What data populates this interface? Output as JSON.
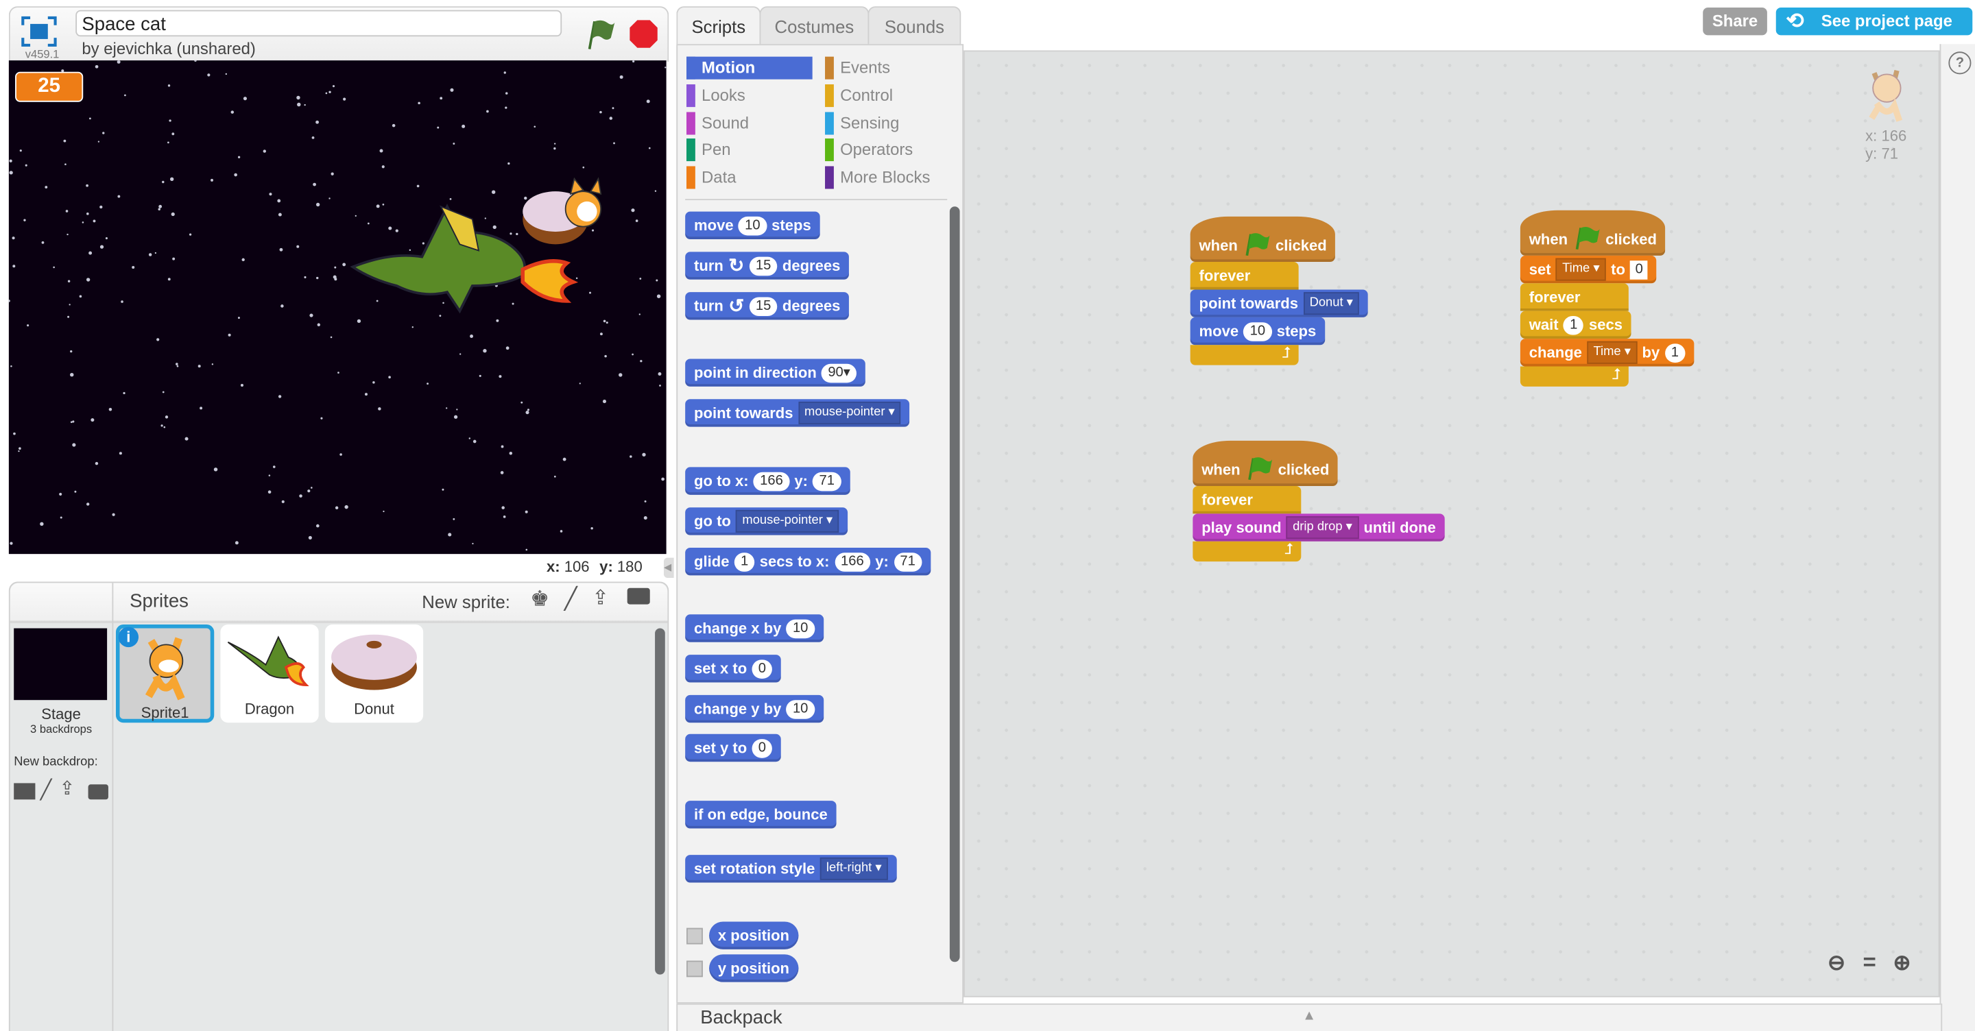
{
  "project": {
    "title": "Space cat",
    "byline": "by ejevichka (unshared)",
    "version": "v459.1"
  },
  "stage": {
    "monitor_value": "25",
    "mouse_x_label": "x:",
    "mouse_x": "106",
    "mouse_y_label": "y:",
    "mouse_y": "180",
    "background": "#0a0011"
  },
  "sprites_pane": {
    "title": "Sprites",
    "new_sprite_label": "New sprite:",
    "stage_label": "Stage",
    "stage_sub": "3 backdrops",
    "new_backdrop_label": "New backdrop:",
    "sprites": [
      {
        "name": "Sprite1",
        "selected": true
      },
      {
        "name": "Dragon"
      },
      {
        "name": "Donut"
      }
    ]
  },
  "tabs": [
    {
      "label": "Scripts",
      "active": true
    },
    {
      "label": "Costumes"
    },
    {
      "label": "Sounds"
    }
  ],
  "header_buttons": {
    "share": "Share",
    "see_project": "See project page"
  },
  "categories": [
    {
      "label": "Motion",
      "color": "#4a6cd4",
      "active": true
    },
    {
      "label": "Events",
      "color": "#c88330"
    },
    {
      "label": "Looks",
      "color": "#8a55d7"
    },
    {
      "label": "Control",
      "color": "#e1a91a"
    },
    {
      "label": "Sound",
      "color": "#bb42c3"
    },
    {
      "label": "Sensing",
      "color": "#2ca5e2"
    },
    {
      "label": "Pen",
      "color": "#0e9a6c"
    },
    {
      "label": "Operators",
      "color": "#5cb712"
    },
    {
      "label": "Data",
      "color": "#ee7d16"
    },
    {
      "label": "More Blocks",
      "color": "#632d99"
    }
  ],
  "colors": {
    "motion": "#4a6cd4",
    "events": "#c88330",
    "control": "#e1a91a",
    "data": "#ee7d16",
    "sound": "#bb42c3",
    "accent": "#25aae1"
  },
  "palette_blocks": [
    [
      {
        "t": "move"
      },
      {
        "n": "10"
      },
      {
        "t": "steps"
      }
    ],
    [
      {
        "t": "turn"
      },
      {
        "i": "rotate-clockwise-icon"
      },
      {
        "n": "15"
      },
      {
        "t": "degrees"
      }
    ],
    [
      {
        "t": "turn"
      },
      {
        "i": "rotate-counterclockwise-icon"
      },
      {
        "n": "15"
      },
      {
        "t": "degrees"
      }
    ],
    [
      {
        "t": "point in direction"
      },
      {
        "n": "90▾"
      }
    ],
    [
      {
        "t": "point towards"
      },
      {
        "d": "mouse-pointer"
      }
    ],
    [
      {
        "t": "go to x:"
      },
      {
        "n": "166"
      },
      {
        "t": "y:"
      },
      {
        "n": "71"
      }
    ],
    [
      {
        "t": "go to"
      },
      {
        "d": "mouse-pointer"
      }
    ],
    [
      {
        "t": "glide"
      },
      {
        "n": "1"
      },
      {
        "t": "secs to x:"
      },
      {
        "n": "166"
      },
      {
        "t": "y:"
      },
      {
        "n": "71"
      }
    ],
    [
      {
        "t": "change x by"
      },
      {
        "n": "10"
      }
    ],
    [
      {
        "t": "set x to"
      },
      {
        "n": "0"
      }
    ],
    [
      {
        "t": "change y by"
      },
      {
        "n": "10"
      }
    ],
    [
      {
        "t": "set y to"
      },
      {
        "n": "0"
      }
    ],
    [
      {
        "t": "if on edge, bounce"
      }
    ],
    [
      {
        "t": "set rotation style"
      },
      {
        "d": "left-right"
      }
    ],
    [
      {
        "t": "x position"
      }
    ],
    [
      {
        "t": "y position"
      }
    ]
  ],
  "scripts": [
    {
      "hat": [
        {
          "t": "when"
        },
        {
          "flag": true
        },
        {
          "t": "clicked"
        }
      ],
      "pre": [],
      "loop": "forever",
      "inner": [
        {
          "cat": "motion",
          "parts": [
            {
              "t": "point towards"
            },
            {
              "d": "Donut"
            }
          ]
        },
        {
          "cat": "motion",
          "parts": [
            {
              "t": "move"
            },
            {
              "n": "10"
            },
            {
              "t": "steps"
            }
          ]
        }
      ]
    },
    {
      "hat": [
        {
          "t": "when"
        },
        {
          "flag": true
        },
        {
          "t": "clicked"
        }
      ],
      "pre": [
        {
          "cat": "data",
          "parts": [
            {
              "t": "set"
            },
            {
              "d": "Time"
            },
            {
              "t": "to"
            },
            {
              "s": "0"
            }
          ]
        }
      ],
      "loop": "forever",
      "inner": [
        {
          "cat": "control",
          "parts": [
            {
              "t": "wait"
            },
            {
              "n": "1"
            },
            {
              "t": "secs"
            }
          ]
        },
        {
          "cat": "data",
          "parts": [
            {
              "t": "change"
            },
            {
              "d": "Time"
            },
            {
              "t": "by"
            },
            {
              "n": "1"
            }
          ]
        }
      ]
    },
    {
      "hat": [
        {
          "t": "when"
        },
        {
          "flag": true
        },
        {
          "t": "clicked"
        }
      ],
      "pre": [],
      "loop": "forever",
      "inner": [
        {
          "cat": "sound",
          "parts": [
            {
              "t": "play sound"
            },
            {
              "d": "drip drop"
            },
            {
              "t": "until done"
            }
          ]
        }
      ]
    }
  ],
  "sprite_info": {
    "x_label": "x:",
    "x": "166",
    "y_label": "y:",
    "y": "71"
  },
  "backpack": {
    "label": "Backpack"
  }
}
